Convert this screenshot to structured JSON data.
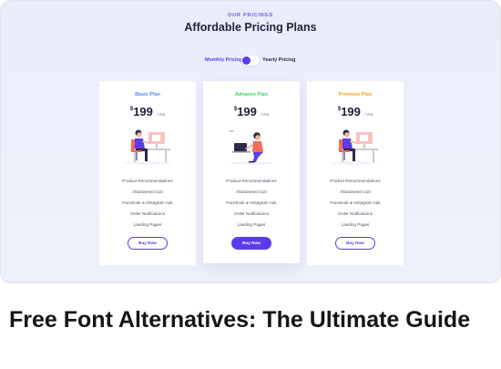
{
  "header": {
    "eyebrow": "OUR PRICINGS",
    "title": "Affordable Pricing Plans"
  },
  "billing_toggle": {
    "monthly_label": "Monthly Pricing",
    "yearly_label": "Yearly Pricing",
    "selected": "Monthly Pricing"
  },
  "plans": [
    {
      "name": "Basic Plan",
      "name_color": "#4e8df5",
      "currency": "$",
      "amount": "199",
      "period": "/ mo",
      "illustration": "person-at-desk-illustration",
      "features": [
        "Product Recommendations",
        "Abandoned Cart",
        "Facebook & Instagram Ads",
        "Order Notifications",
        "Landing Pages"
      ],
      "button_label": "Buy Now",
      "button_style": "outline"
    },
    {
      "name": "Advance Plan",
      "name_color": "#3ccf6a",
      "currency": "$",
      "amount": "199",
      "period": "/ mo",
      "illustration": "person-with-laptop-illustration",
      "features": [
        "Product Recommendations",
        "Abandoned Cart",
        "Facebook & Instagram Ads",
        "Order Notifications",
        "Landing Pages"
      ],
      "button_label": "Buy Now",
      "button_style": "solid"
    },
    {
      "name": "Premium Plan",
      "name_color": "#f5a623",
      "currency": "$",
      "amount": "199",
      "period": "/ mo",
      "illustration": "person-at-desk-illustration",
      "features": [
        "Product Recommendations",
        "Abandoned Cart",
        "Facebook & Instagram Ads",
        "Order Notifications",
        "Landing Pages"
      ],
      "button_label": "Buy Now",
      "button_style": "outline"
    }
  ],
  "article": {
    "title": "Free Font Alternatives: The Ultimate Guide"
  },
  "colors": {
    "accent": "#5b3ce8",
    "background": "#ecefff"
  }
}
